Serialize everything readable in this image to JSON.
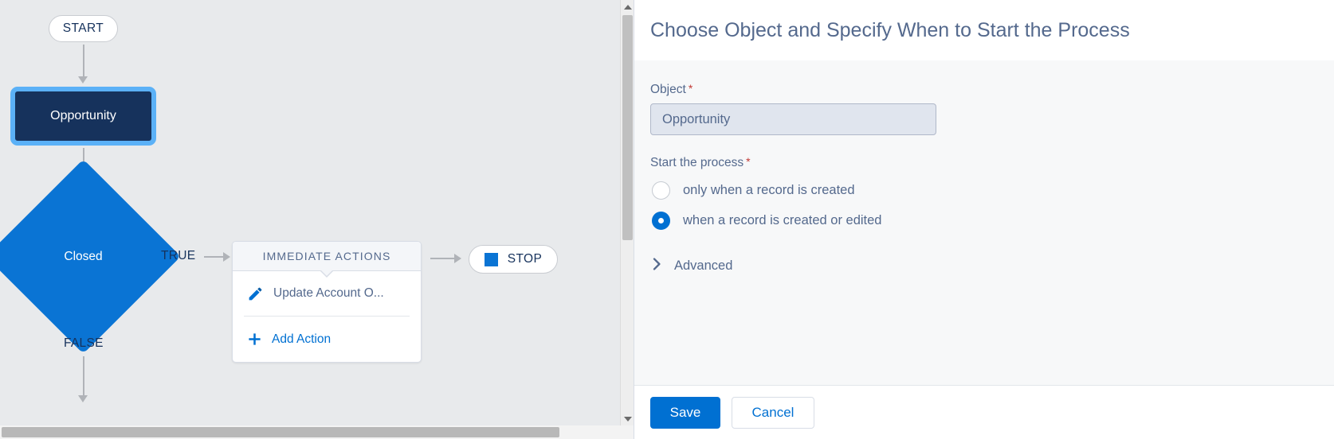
{
  "canvas": {
    "start_node": {
      "label": "START"
    },
    "object_node": {
      "label": "Opportunity"
    },
    "decision_node": {
      "label": "Closed"
    },
    "branch_true": "TRUE",
    "branch_false": "FALSE",
    "actions_card": {
      "header": "IMMEDIATE ACTIONS",
      "rows": [
        {
          "label": "Update Account O...",
          "icon": "pencil-icon"
        },
        {
          "label": "Add Action",
          "icon": "plus-icon"
        }
      ]
    },
    "stop_node": {
      "label": "STOP",
      "icon": "stop-square-icon"
    }
  },
  "panel": {
    "title": "Choose Object and Specify When to Start the Process",
    "object_field": {
      "label": "Object",
      "required_marker": "*",
      "value": "Opportunity",
      "placeholder": "Opportunity"
    },
    "start_process": {
      "label": "Start the process",
      "required_marker": "*",
      "options": [
        {
          "label": "only when a record is created",
          "selected": false
        },
        {
          "label": "when a record is created or edited",
          "selected": true
        }
      ]
    },
    "advanced": {
      "label": "Advanced",
      "icon": "chevron-right-icon",
      "expanded": false
    },
    "footer": {
      "save_label": "Save",
      "cancel_label": "Cancel"
    }
  },
  "colors": {
    "canvas_bg": "#e8eaec",
    "object_node_bg": "#16325c",
    "selection_border": "#5bb1f7",
    "decision_bg": "#0a74d4",
    "brand_blue": "#0070d2",
    "label_text": "#54698d",
    "required_red": "#c23934"
  }
}
